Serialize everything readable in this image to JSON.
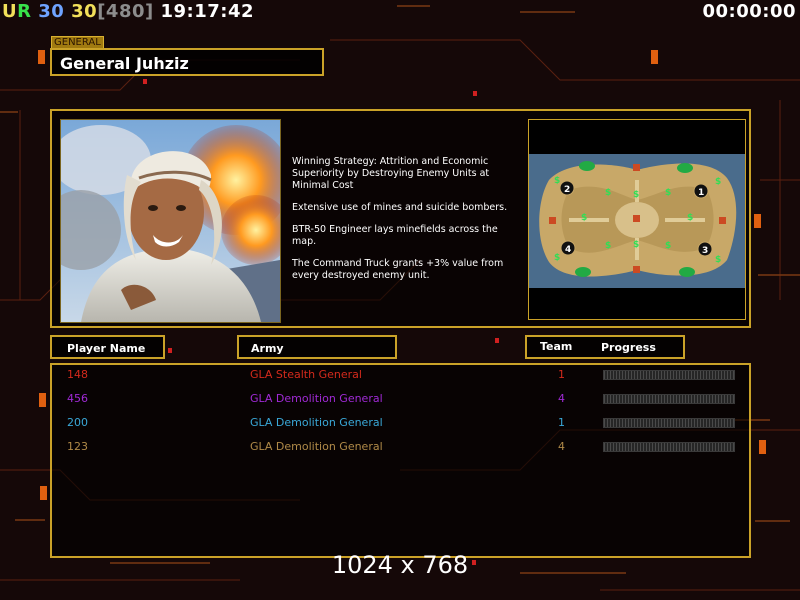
{
  "hud": {
    "tag_ur": "UR",
    "val1": "30",
    "val2": "30",
    "bracket": "[480]",
    "clock": "19:17:42",
    "timer": "00:00:00"
  },
  "general": {
    "tag": "GENERAL",
    "name": "General Juhziz"
  },
  "strategy": {
    "lines": [
      "Winning Strategy: Attrition and Economic Superiority by Destroying Enemy Units at Minimal Cost",
      "Extensive use of mines and suicide bombers.",
      "BTR-50 Engineer lays minefields across the map.",
      "The Command Truck grants +3% value from every destroyed enemy unit."
    ]
  },
  "minimap": {
    "starts": [
      "1",
      "2",
      "3",
      "4"
    ],
    "supply_marker": "$"
  },
  "table": {
    "headers": {
      "player": "Player Name",
      "army": "Army",
      "team": "Team",
      "progress": "Progress"
    },
    "rows": [
      {
        "name": "148",
        "army": "GLA Stealth General",
        "team": "1",
        "color": "#d42a1c",
        "progress": 0
      },
      {
        "name": "456",
        "army": "GLA Demolition General",
        "team": "4",
        "color": "#a02ad6",
        "progress": 0
      },
      {
        "name": "200",
        "army": "GLA Demolition General",
        "team": "1",
        "color": "#3aa8d8",
        "progress": 0
      },
      {
        "name": "123",
        "army": "GLA Demolition General",
        "team": "4",
        "color": "#b08a48",
        "progress": 0
      }
    ]
  },
  "resolution_label": "1024 x 768"
}
